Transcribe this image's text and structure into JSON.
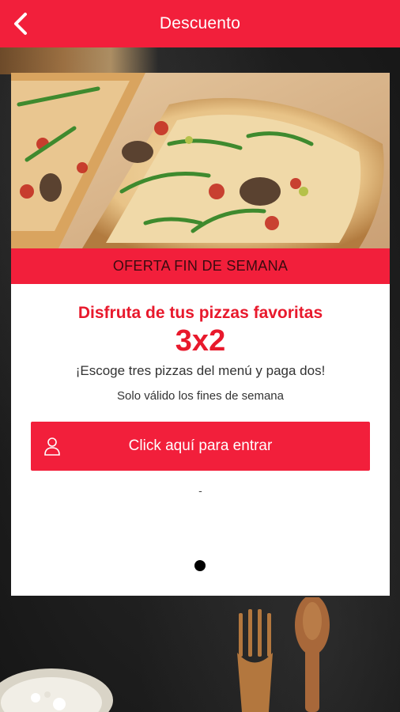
{
  "header": {
    "title": "Descuento",
    "background_color": "#f21f3b",
    "back_icon": "chevron-left-icon"
  },
  "promo_card": {
    "banner_label": "OFERTA FIN DE SEMANA",
    "headline": "Disfruta de tus pizzas favoritas",
    "promo": "3x2",
    "description": "¡Escoge tres pizzas del menú y paga dos!",
    "note": "Solo válido los fines de semana",
    "button": {
      "label": "Click aquí para entrar",
      "icon": "user-icon"
    },
    "separator": "-",
    "page_indicator": {
      "pages": 1,
      "current": 1
    }
  },
  "colors": {
    "accent": "#f21f3b",
    "headline_text": "#e8192c"
  }
}
